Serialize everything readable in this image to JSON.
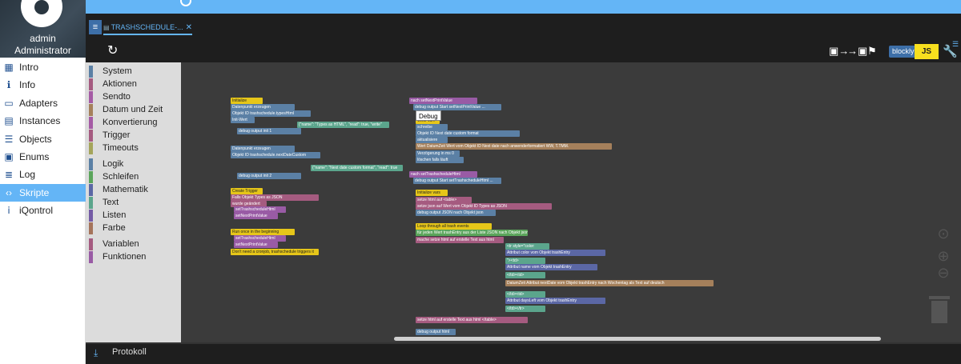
{
  "sidebar": {
    "user_name": "admin",
    "user_role": "Administrator",
    "items": [
      {
        "label": "Intro",
        "icon": "grid-icon"
      },
      {
        "label": "Info",
        "icon": "info-icon"
      },
      {
        "label": "Adapters",
        "icon": "store-icon"
      },
      {
        "label": "Instances",
        "icon": "instances-icon"
      },
      {
        "label": "Objects",
        "icon": "list-icon"
      },
      {
        "label": "Enums",
        "icon": "enums-icon"
      },
      {
        "label": "Log",
        "icon": "log-icon"
      },
      {
        "label": "Skripte",
        "icon": "code-icon"
      },
      {
        "label": "iQontrol",
        "icon": "iqontrol-icon"
      }
    ],
    "active_index": 7
  },
  "tabs": [
    {
      "label": "TRASHSCHEDULE-..."
    }
  ],
  "toolbar": {
    "blockly_label": "blockly",
    "js_label": "JS"
  },
  "categories": [
    {
      "label": "System",
      "color": "#5b80a5"
    },
    {
      "label": "Aktionen",
      "color": "#a55b80"
    },
    {
      "label": "Sendto",
      "color": "#a55ba5"
    },
    {
      "label": "Datum und Zeit",
      "color": "#a5805b"
    },
    {
      "label": "Konvertierung",
      "color": "#a55ba5"
    },
    {
      "label": "Trigger",
      "color": "#a55b80"
    },
    {
      "label": "Timeouts",
      "color": "#a5a55b"
    },
    {
      "label": "Logik",
      "color": "#5b80a5"
    },
    {
      "label": "Schleifen",
      "color": "#5ba55b"
    },
    {
      "label": "Mathematik",
      "color": "#5b67a5"
    },
    {
      "label": "Text",
      "color": "#5ba58c"
    },
    {
      "label": "Listen",
      "color": "#745ba5"
    },
    {
      "label": "Farbe",
      "color": "#a5745b"
    },
    {
      "label": "Variablen",
      "color": "#a55b80"
    },
    {
      "label": "Funktionen",
      "color": "#995ba5"
    }
  ],
  "tooltip": "Debug",
  "blocks_left": [
    {
      "text": "Initialize",
      "color": "#e6c619"
    },
    {
      "text": "Datenpunkt erzeugen",
      "color": "#5b80a5"
    },
    {
      "text": "Objekt ID trashschedule.typesHtml",
      "color": "#5b80a5"
    },
    {
      "text": "Init-Wert",
      "color": "#5b80a5"
    },
    {
      "text": "{\"name\": \"Types as HTML\", \"read\": true, \"write\"",
      "color": "#5ba58c"
    },
    {
      "text": "debug output  init 1",
      "color": "#5b80a5"
    },
    {
      "text": "Datenpunkt erzeugen",
      "color": "#5b80a5"
    },
    {
      "text": "Objekt ID trashschedule.nextDateCustom",
      "color": "#5b80a5"
    },
    {
      "text": "{\"name\": \"Next date custom format\", \"read\": true",
      "color": "#5ba58c"
    },
    {
      "text": "debug output  init 2",
      "color": "#5b80a5"
    },
    {
      "text": "Create Trigger",
      "color": "#e6c619"
    },
    {
      "text": "Falls Objekt  Types as JSON",
      "color": "#a55b80"
    },
    {
      "text": "wurde geändert",
      "color": "#a55b80"
    },
    {
      "text": "setTrashscheduleHtml",
      "color": "#995ba5"
    },
    {
      "text": "setNextPrintValue",
      "color": "#995ba5"
    },
    {
      "text": "Run once in the beginning",
      "color": "#e6c619"
    },
    {
      "text": "setTrashscheduleHtml",
      "color": "#995ba5"
    },
    {
      "text": "setNextPrintValue",
      "color": "#995ba5"
    },
    {
      "text": "Don't need a cronjob, trashschedule triggers it",
      "color": "#e6c619"
    }
  ],
  "blocks_right": [
    {
      "text": "nach setNextPrintValue",
      "color": "#995ba5"
    },
    {
      "text": "debug output  Start setNextPrintValue ...",
      "color": "#5b80a5"
    },
    {
      "text": "Write va...",
      "color": "#e6c619"
    },
    {
      "text": "schreibe",
      "color": "#5b80a5"
    },
    {
      "text": "Objekt ID  Next date custom format",
      "color": "#5b80a5"
    },
    {
      "text": "aktualisiere",
      "color": "#5b80a5"
    },
    {
      "text": "Wert  DatumZeit  Wert vom Objekt ID Next date  nach  anwenderformatiert  WW, T.TMM.",
      "color": "#a5805b"
    },
    {
      "text": "Verzögerung in ms  0",
      "color": "#5b80a5"
    },
    {
      "text": "löschen falls läuft",
      "color": "#5b80a5"
    },
    {
      "text": "nach setTrashscheduleHtml",
      "color": "#995ba5"
    },
    {
      "text": "debug output  Start setTrashscheduleHtml ...",
      "color": "#5b80a5"
    },
    {
      "text": "Initialize vars",
      "color": "#e6c619"
    },
    {
      "text": "setze html auf  <table>",
      "color": "#a55b80"
    },
    {
      "text": "setze json auf  Wert vom Objekt ID  Types as JSON",
      "color": "#a55b80"
    },
    {
      "text": "debug output  JSON nach Objekt  json",
      "color": "#5b80a5"
    },
    {
      "text": "Loop through all trash events",
      "color": "#e6c619"
    },
    {
      "text": "für jeden Wert trashEntry aus der Liste  JSON nach Objekt  json",
      "color": "#5ba55b"
    },
    {
      "text": "mache  setze html auf  erstelle Text aus  html",
      "color": "#a55b80"
    },
    {
      "text": "<tr style=\"color:",
      "color": "#5ba58c"
    },
    {
      "text": "Attribut  color  vom Objekt  trashEntry",
      "color": "#5b67a5"
    },
    {
      "text": "\"><td>",
      "color": "#5ba58c"
    },
    {
      "text": "Attribut  name  vom Objekt  trashEntry",
      "color": "#5b67a5"
    },
    {
      "text": "</td><td>",
      "color": "#5ba58c"
    },
    {
      "text": "DatumZeit  Attribut  nextDate  vom Objekt  trashEntry  nach  Wochentag als Text  auf deutsch",
      "color": "#a5805b"
    },
    {
      "text": "</td><td>",
      "color": "#5ba58c"
    },
    {
      "text": "Attribut  daysLeft  vom Objekt  trashEntry",
      "color": "#5b67a5"
    },
    {
      "text": "</td></tr>",
      "color": "#5ba58c"
    },
    {
      "text": "setze html auf  erstelle Text aus  html  </table>",
      "color": "#a55b80"
    },
    {
      "text": "debug output  html",
      "color": "#5b80a5"
    }
  ],
  "bottom": {
    "log_label": "Protokoll"
  }
}
